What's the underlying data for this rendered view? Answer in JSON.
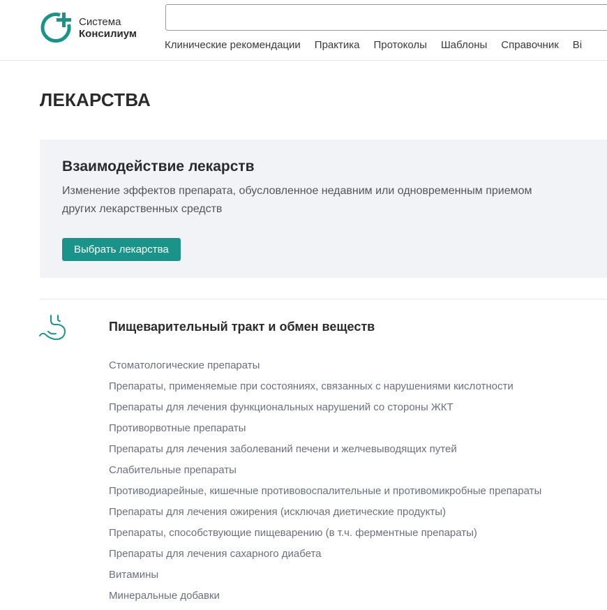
{
  "header": {
    "logo": {
      "line1": "Система",
      "line2": "Консилиум",
      "icon": "plus-circle-logo-icon",
      "color": "#1a9488"
    },
    "search": {
      "value": "",
      "placeholder": ""
    },
    "nav": [
      {
        "label": "Клинические рекомендации"
      },
      {
        "label": "Практика"
      },
      {
        "label": "Протоколы"
      },
      {
        "label": "Шаблоны"
      },
      {
        "label": "Справочник"
      },
      {
        "label": "Ві"
      }
    ]
  },
  "page": {
    "title": "ЛЕКАРСТВА"
  },
  "promo": {
    "title": "Взаимодействие лекарств",
    "description": "Изменение эффектов препарата, обусловленное недавним или одновременным приемом других лекарственных средств",
    "button_label": "Выбрать лекарства",
    "accent": "#1a9488",
    "background": "#f2f3f6"
  },
  "category": {
    "icon": "stomach-icon",
    "title": "Пищеварительный тракт и обмен веществ",
    "items": [
      "Стоматологические препараты",
      "Препараты, применяемые при состояниях, связанных с нарушениями кислотности",
      "Препараты для лечения функциональных нарушений со стороны ЖКТ",
      "Противорвотные препараты",
      "Препараты для лечения заболеваний печени и желчевыводящих путей",
      "Слабительные препараты",
      "Противодиарейные, кишечные противовоспалительные и противомикробные препараты",
      "Препараты для лечения ожирения (исключая диетические продукты)",
      "Препараты, способствующие пищеварению (в т.ч. ферментные препараты)",
      "Препараты для лечения сахарного диабета",
      "Витамины",
      "Минеральные добавки"
    ]
  }
}
